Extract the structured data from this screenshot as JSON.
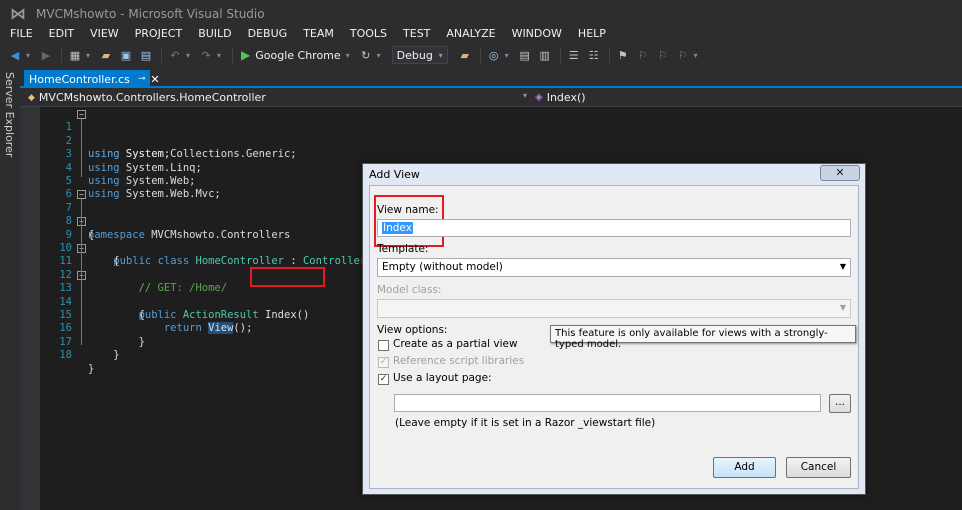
{
  "window": {
    "title": "MVCMshowto - Microsoft Visual Studio"
  },
  "menu": [
    "FILE",
    "EDIT",
    "VIEW",
    "PROJECT",
    "BUILD",
    "DEBUG",
    "TEAM",
    "TOOLS",
    "TEST",
    "ANALYZE",
    "WINDOW",
    "HELP"
  ],
  "toolbar": {
    "run_target": "Google Chrome",
    "configuration": "Debug"
  },
  "side_panel": {
    "label": "Server Explorer"
  },
  "document_tab": {
    "label": "HomeController.cs"
  },
  "navbar": {
    "class": "MVCMshowto.Controllers.HomeController",
    "member": "Index()"
  },
  "code": {
    "line_numbers": [
      "1",
      "2",
      "3",
      "4",
      "5",
      "6",
      "7",
      "8",
      "9",
      "10",
      "11",
      "12",
      "13",
      "14",
      "15",
      "16",
      "17",
      "18"
    ],
    "lines": {
      "l1_kw": "using",
      "l1_rest": " System;",
      "l2_kw": "using",
      "l2_rest": " System.Collections.Generic;",
      "l3_kw": "using",
      "l3_rest": " System.Linq;",
      "l4_kw": "using",
      "l4_rest": " System.Web;",
      "l5_kw": "using",
      "l5_rest": " System.Web.Mvc;",
      "l7_kw": "namespace",
      "l7_rest": " MVCMshowto.Controllers",
      "l8": "{",
      "l9_kw1": "public",
      "l9_kw2": "class",
      "l9_name": "HomeController",
      "l9_colon": " : ",
      "l9_base": "Controller",
      "l10": "{",
      "l11": "//",
      "l12": "// GET: /Home/",
      "l13_kw": "public",
      "l13_type": "ActionResult",
      "l13_method": "Index()",
      "l14": "{",
      "l15_kw": "return",
      "l15_call": "View",
      "l15_rest": "();",
      "l16": "}",
      "l17": "}",
      "l18": "}"
    }
  },
  "dialog": {
    "title": "Add View",
    "close": "✕",
    "view_name_label": "View name:",
    "view_name_value": "Index",
    "template_label": "Template:",
    "template_value": "Empty (without model)",
    "model_class_label": "Model class:",
    "model_class_value": "",
    "view_options_label": "View options:",
    "tooltip": "This feature is only available for views with a strongly-typed model.",
    "options": {
      "partial_view": {
        "label": "Create as a partial view",
        "checked": false,
        "enabled": true
      },
      "script_libs": {
        "label": "Reference script libraries",
        "checked": true,
        "enabled": false
      },
      "layout_page": {
        "label": "Use a layout page:",
        "checked": true,
        "enabled": true
      }
    },
    "layout_path_value": "",
    "browse_label": "...",
    "layout_hint": "(Leave empty if it is set in a Razor _viewstart file)",
    "add_label": "Add",
    "cancel_label": "Cancel"
  }
}
